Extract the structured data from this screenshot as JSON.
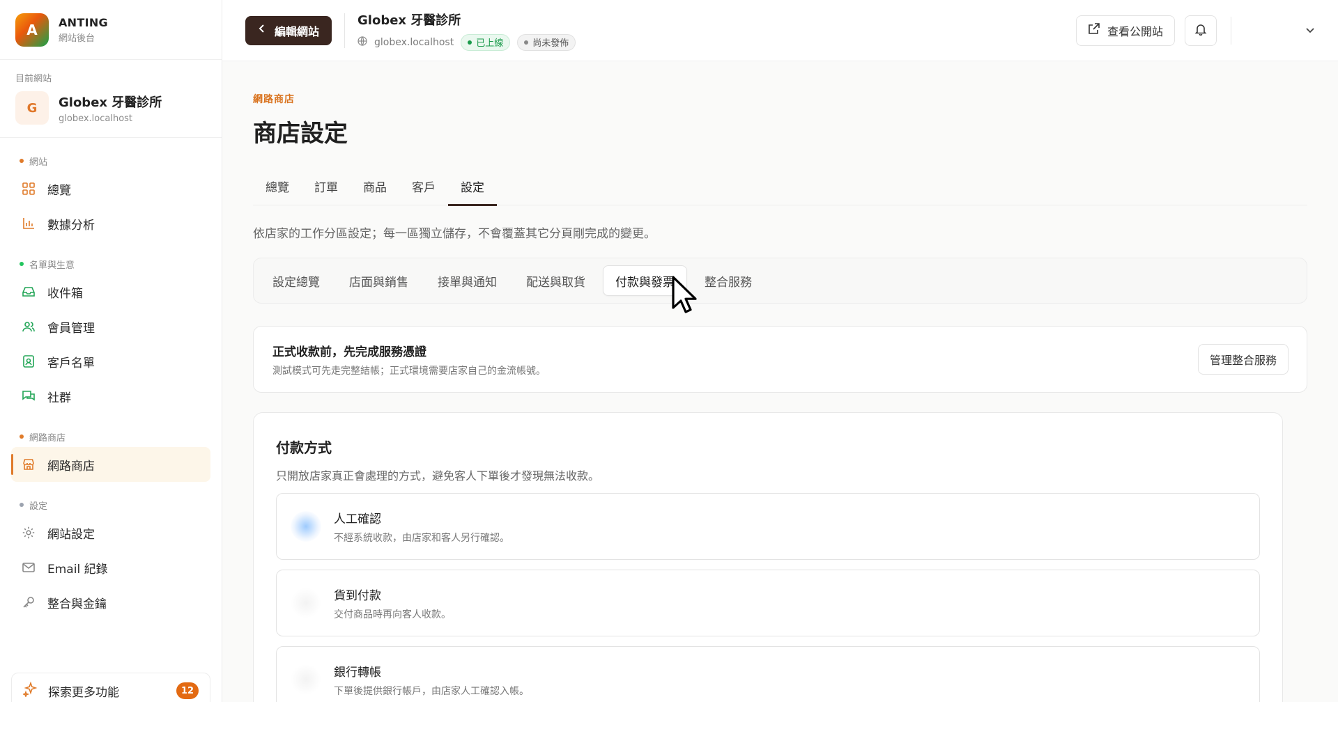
{
  "brand": {
    "logo_letter": "A",
    "name": "ANTING",
    "subtitle": "網站後台"
  },
  "current_site": {
    "caption": "目前網站",
    "avatar_letter": "G",
    "name": "Globex 牙醫診所",
    "domain": "globex.localhost"
  },
  "sidebar": {
    "groups": [
      {
        "title": "網站",
        "dot_color": "#e07b2a",
        "items": [
          {
            "label": "總覽",
            "icon": "grid-icon"
          },
          {
            "label": "數據分析",
            "icon": "bar-chart-icon"
          }
        ]
      },
      {
        "title": "名單與生意",
        "dot_color": "#22c55e",
        "items": [
          {
            "label": "收件箱",
            "icon": "inbox-icon"
          },
          {
            "label": "會員管理",
            "icon": "users-icon"
          },
          {
            "label": "客戶名單",
            "icon": "contact-card-icon"
          },
          {
            "label": "社群",
            "icon": "chat-icon"
          }
        ]
      },
      {
        "title": "網路商店",
        "dot_color": "#e07b2a",
        "items": [
          {
            "label": "網路商店",
            "icon": "store-icon",
            "active": true
          }
        ]
      },
      {
        "title": "設定",
        "dot_color": "#9ca3af",
        "items": [
          {
            "label": "網站設定",
            "icon": "gear-icon"
          },
          {
            "label": "Email 紀錄",
            "icon": "mail-icon"
          },
          {
            "label": "整合與金鑰",
            "icon": "key-icon"
          }
        ]
      }
    ],
    "explore": {
      "label": "探索更多功能",
      "badge": "12"
    }
  },
  "topbar": {
    "back_label": "編輯網站",
    "site_title": "Globex 牙醫診所",
    "site_domain": "globex.localhost",
    "status_live": "已上線",
    "status_draft": "尚未發佈",
    "view_public": "查看公開站"
  },
  "page": {
    "eyebrow": "網路商店",
    "title": "商店設定",
    "tabs": [
      "總覽",
      "訂單",
      "商品",
      "客戶",
      "設定"
    ],
    "active_tab": 4,
    "description": "依店家的工作分區設定；每一區獨立儲存，不會覆蓋其它分頁剛完成的變更。",
    "subtabs": [
      "設定總覽",
      "店面與銷售",
      "接單與通知",
      "配送與取貨",
      "付款與發票",
      "整合服務"
    ],
    "active_subtab": 4
  },
  "notice": {
    "title": "正式收款前，先完成服務憑證",
    "desc": "測試模式可先走完整結帳；正式環境需要店家自己的金流帳號。",
    "button": "管理整合服務"
  },
  "payment": {
    "title": "付款方式",
    "desc": "只開放店家真正會處理的方式，避免客人下單後才發現無法收款。",
    "methods": [
      {
        "title": "人工確認",
        "desc": "不經系統收款，由店家和客人另行確認。"
      },
      {
        "title": "貨到付款",
        "desc": "交付商品時再向客人收款。"
      },
      {
        "title": "銀行轉帳",
        "desc": "下單後提供銀行帳戶，由店家人工確認入帳。"
      }
    ]
  },
  "colors": {
    "accent": "#e07b2a",
    "dark_button": "#3a2620",
    "badge": "#e36a12",
    "live_green": "#1a9a4b"
  }
}
